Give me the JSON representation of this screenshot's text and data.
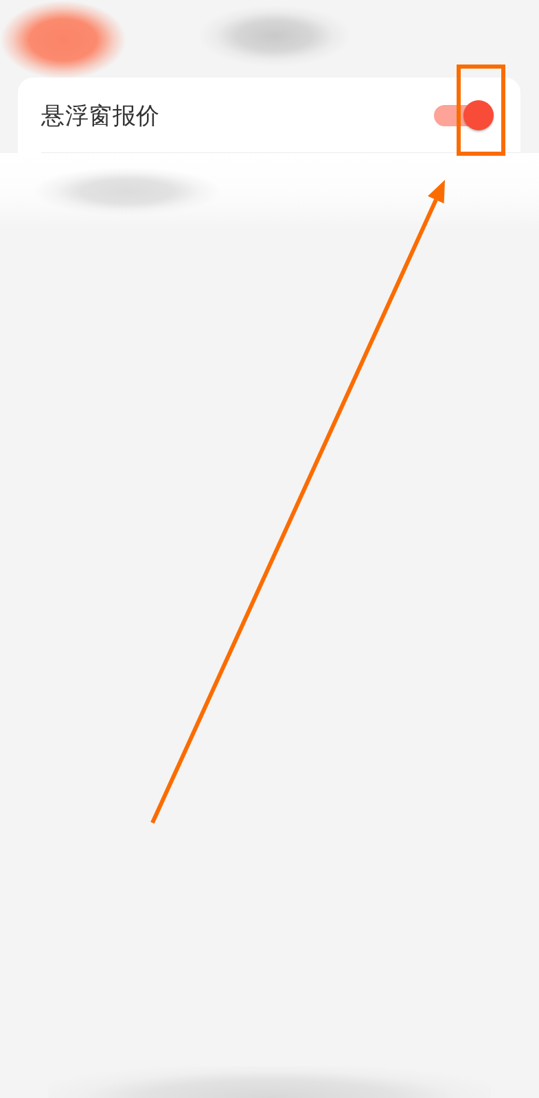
{
  "settings_list": {
    "rows": [
      {
        "kind": "toggle",
        "label": "悬浮窗报价",
        "on": true
      }
    ]
  }
}
